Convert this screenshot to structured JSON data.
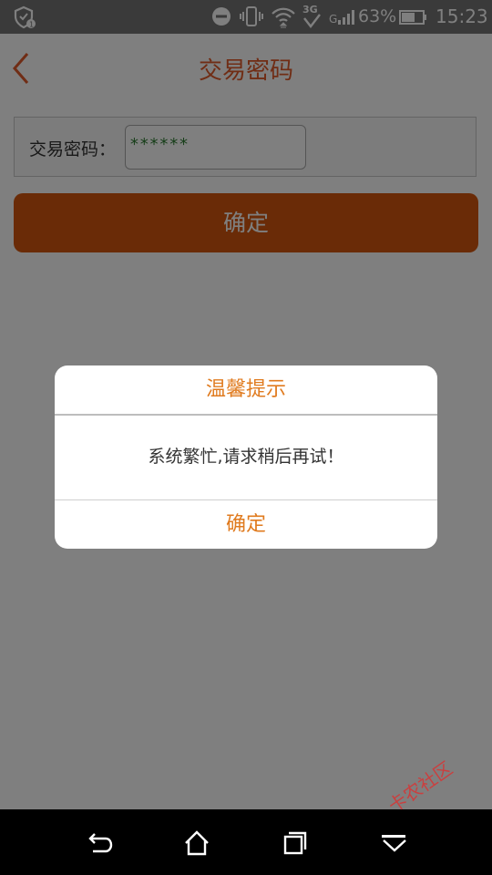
{
  "status_bar": {
    "battery_percent": "63%",
    "time": "15:23",
    "network_type": "3G",
    "signal_label": "G"
  },
  "header": {
    "title": "交易密码"
  },
  "form": {
    "label": "交易密码：",
    "password_value": "******",
    "submit_label": "确定"
  },
  "dialog": {
    "title": "温馨提示",
    "message": "系统繁忙,请求稍后再试！",
    "confirm_label": "确定"
  },
  "watermark": {
    "text": "卡农社区"
  },
  "colors": {
    "accent": "#e05a2a",
    "dialog_accent": "#e07b1f",
    "button": "#d4570e",
    "password_text": "#2e7d32"
  }
}
